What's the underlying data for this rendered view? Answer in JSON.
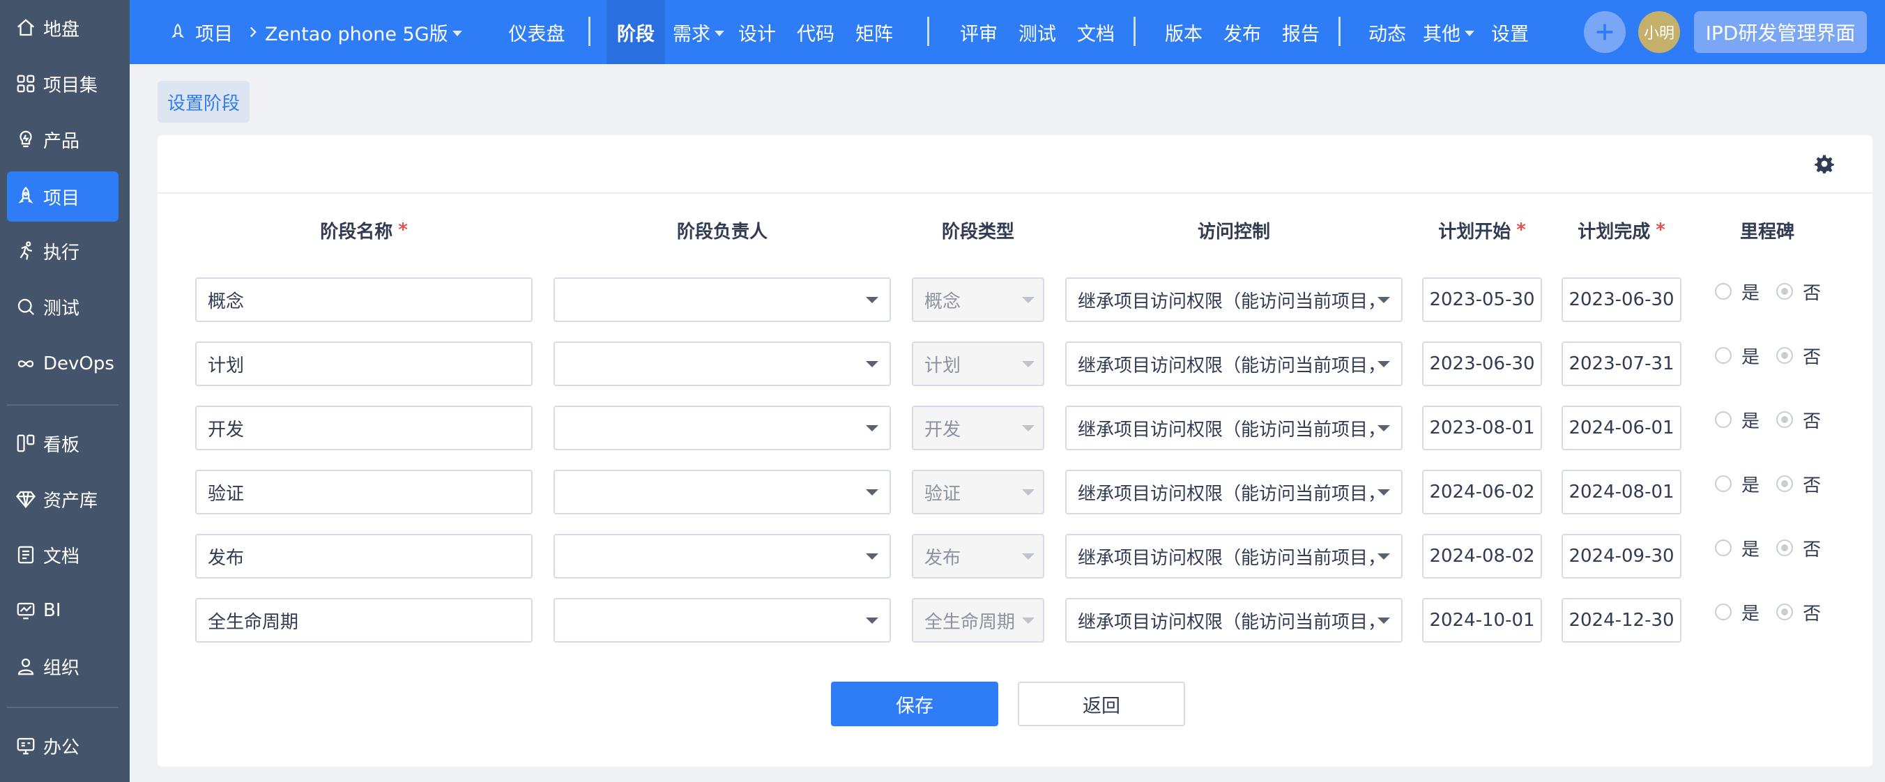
{
  "sidebar": {
    "items": [
      {
        "label": "地盘",
        "icon": "home-icon"
      },
      {
        "label": "项目集",
        "icon": "grid-icon"
      },
      {
        "label": "产品",
        "icon": "lightbulb-icon"
      },
      {
        "label": "项目",
        "icon": "rocket-icon"
      },
      {
        "label": "执行",
        "icon": "run-icon"
      },
      {
        "label": "测试",
        "icon": "search-icon"
      },
      {
        "label": "DevOps",
        "icon": "infinity-icon"
      },
      {
        "label": "看板",
        "icon": "kanban-icon"
      },
      {
        "label": "资产库",
        "icon": "diamond-icon"
      },
      {
        "label": "文档",
        "icon": "document-icon"
      },
      {
        "label": "BI",
        "icon": "chart-icon"
      },
      {
        "label": "组织",
        "icon": "user-icon"
      },
      {
        "label": "办公",
        "icon": "office-icon"
      }
    ],
    "active_index": 3
  },
  "header": {
    "breadcrumb_root": "项目",
    "project_name": "Zentao phone 5G版",
    "nav": [
      {
        "label": "仪表盘"
      },
      {
        "label": "阶段"
      },
      {
        "label": "需求"
      },
      {
        "label": "设计"
      },
      {
        "label": "代码"
      },
      {
        "label": "矩阵"
      },
      {
        "label": "评审"
      },
      {
        "label": "测试"
      },
      {
        "label": "文档"
      },
      {
        "label": "版本"
      },
      {
        "label": "发布"
      },
      {
        "label": "报告"
      },
      {
        "label": "动态"
      },
      {
        "label": "其他"
      },
      {
        "label": "设置"
      }
    ],
    "active_nav": "阶段",
    "avatar_text": "小明",
    "ipd_button": "IPD研发管理界面"
  },
  "page": {
    "sub_tab": "设置阶段",
    "columns": {
      "name": "阶段名称",
      "owner": "阶段负责人",
      "type": "阶段类型",
      "acl": "访问控制",
      "begin": "计划开始",
      "end": "计划完成",
      "milestone": "里程碑"
    },
    "required_mark": "*",
    "radio_yes": "是",
    "radio_no": "否",
    "rows": [
      {
        "name": "概念",
        "owner": "",
        "type": "概念",
        "acl": "继承项目访问权限（能访问当前项目，",
        "begin": "2023-05-30",
        "end": "2023-06-30",
        "milestone": "否"
      },
      {
        "name": "计划",
        "owner": "",
        "type": "计划",
        "acl": "继承项目访问权限（能访问当前项目，",
        "begin": "2023-06-30",
        "end": "2023-07-31",
        "milestone": "否"
      },
      {
        "name": "开发",
        "owner": "",
        "type": "开发",
        "acl": "继承项目访问权限（能访问当前项目，",
        "begin": "2023-08-01",
        "end": "2024-06-01",
        "milestone": "否"
      },
      {
        "name": "验证",
        "owner": "",
        "type": "验证",
        "acl": "继承项目访问权限（能访问当前项目，",
        "begin": "2024-06-02",
        "end": "2024-08-01",
        "milestone": "否"
      },
      {
        "name": "发布",
        "owner": "",
        "type": "发布",
        "acl": "继承项目访问权限（能访问当前项目，",
        "begin": "2024-08-02",
        "end": "2024-09-30",
        "milestone": "否"
      },
      {
        "name": "全生命周期",
        "owner": "",
        "type": "全生命周期",
        "acl": "继承项目访问权限（能访问当前项目，",
        "begin": "2024-10-01",
        "end": "2024-12-30",
        "milestone": "否"
      }
    ],
    "save_label": "保存",
    "back_label": "返回"
  },
  "colors": {
    "primary": "#2e7cf6",
    "sidebar": "#44546a",
    "required": "#e84f4f"
  }
}
